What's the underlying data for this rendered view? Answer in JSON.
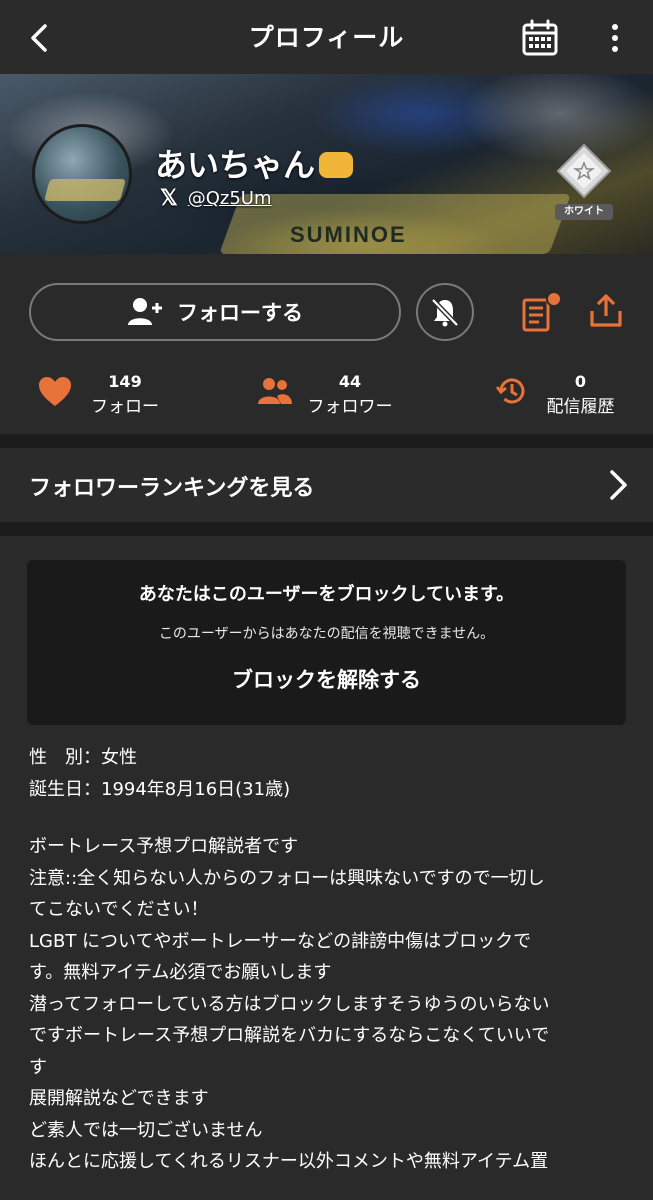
{
  "header": {
    "title": "プロフィール"
  },
  "banner": {
    "boat_text": "SUMINOE"
  },
  "profile": {
    "name": "あいちゃん",
    "x_handle": "@Qz5Um",
    "x_label": "𝕏",
    "rank_label": "ホワイト"
  },
  "actions": {
    "follow_label": "フォローする"
  },
  "stats": {
    "follow": {
      "count": "149",
      "label": "フォロー"
    },
    "followers": {
      "count": "44",
      "label": "フォロワー"
    },
    "history": {
      "count": "0",
      "label": "配信履歴"
    }
  },
  "ranking_link": {
    "label": "フォロワーランキングを見る"
  },
  "block_notice": {
    "title": "あなたはこのユーザーをブロックしています。",
    "subtitle": "このユーザーからはあなたの配信を視聴できません。",
    "unblock_label": "ブロックを解除する"
  },
  "info": {
    "gender": "性　別：女性",
    "birthday": "誕生日：1994年8月16日(31歳)"
  },
  "bio_lines": [
    "ボートレース予想プロ解説者です",
    "注意::全く知らない人からのフォローは興味ないですので一切し",
    "てこないでください！",
    "LGBT についてやボートレーサーなどの誹謗中傷はブロックで",
    "す。無料アイテム必須でお願いします",
    "潜ってフォローしている方はブロックしますそうゆうのいらない",
    "ですボートレース予想プロ解説をバカにするならこなくていいで",
    "す",
    "展開解説などできます",
    "ど素人では一切ございません",
    "ほんとに応援してくれるリスナー以外コメントや無料アイテム置"
  ],
  "colors": {
    "accent": "#e8733a",
    "background": "#2a2a2a",
    "separator": "#1c1c1c",
    "notice_bg": "#1a1a1a"
  }
}
